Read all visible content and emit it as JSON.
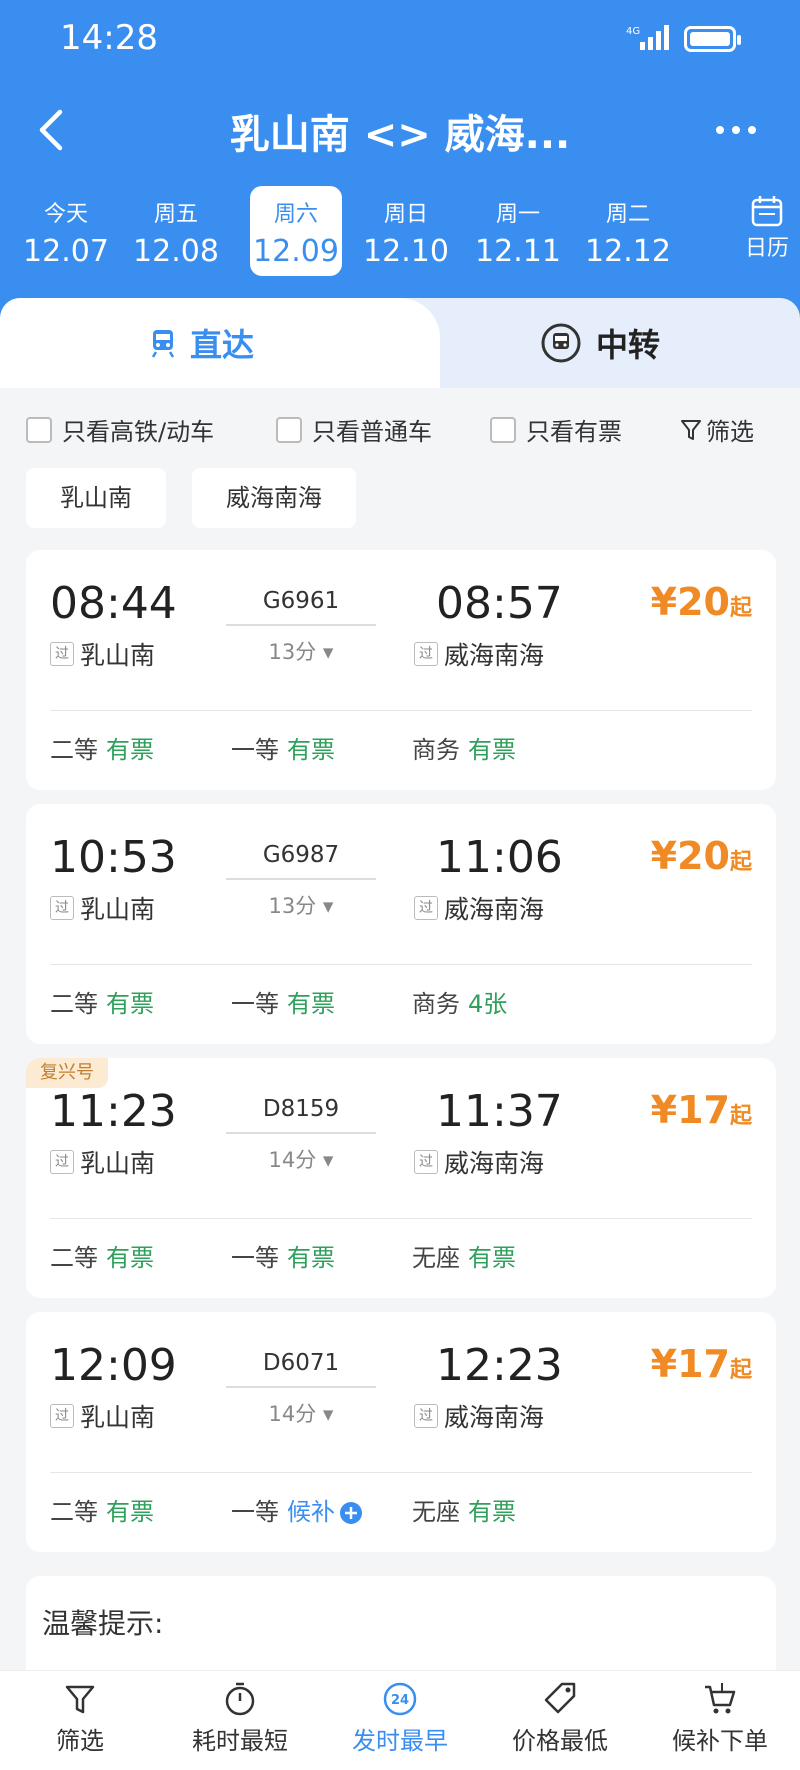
{
  "status_bar": {
    "time": "14:28",
    "network": "4G"
  },
  "header": {
    "title": "乳山南 <> 威海..."
  },
  "dates": [
    {
      "weekday": "今天",
      "date": "12.07",
      "active": false
    },
    {
      "weekday": "周五",
      "date": "12.08",
      "active": false
    },
    {
      "weekday": "周六",
      "date": "12.09",
      "active": true
    },
    {
      "weekday": "周日",
      "date": "12.10",
      "active": false
    },
    {
      "weekday": "周一",
      "date": "12.11",
      "active": false
    },
    {
      "weekday": "周二",
      "date": "12.12",
      "active": false
    }
  ],
  "calendar_label": "日历",
  "tabs": {
    "direct": "直达",
    "transfer": "中转"
  },
  "filters": {
    "high_speed": "只看高铁/动车",
    "normal": "只看普通车",
    "available": "只看有票",
    "filter_link": "筛选"
  },
  "stations": [
    "乳山南",
    "威海南海"
  ],
  "pass_badge": "过",
  "price_suffix": "起",
  "trains": [
    {
      "dep": "08:44",
      "arr": "08:57",
      "no": "G6961",
      "duration": "13分",
      "from": "乳山南",
      "to": "威海南海",
      "price": "¥20",
      "tag": "",
      "seats": [
        {
          "class": "二等",
          "status": "有票",
          "wait": false
        },
        {
          "class": "一等",
          "status": "有票",
          "wait": false
        },
        {
          "class": "商务",
          "status": "有票",
          "wait": false
        }
      ]
    },
    {
      "dep": "10:53",
      "arr": "11:06",
      "no": "G6987",
      "duration": "13分",
      "from": "乳山南",
      "to": "威海南海",
      "price": "¥20",
      "tag": "",
      "seats": [
        {
          "class": "二等",
          "status": "有票",
          "wait": false
        },
        {
          "class": "一等",
          "status": "有票",
          "wait": false
        },
        {
          "class": "商务",
          "status": "4张",
          "wait": false
        }
      ]
    },
    {
      "dep": "11:23",
      "arr": "11:37",
      "no": "D8159",
      "duration": "14分",
      "from": "乳山南",
      "to": "威海南海",
      "price": "¥17",
      "tag": "复兴号",
      "seats": [
        {
          "class": "二等",
          "status": "有票",
          "wait": false
        },
        {
          "class": "一等",
          "status": "有票",
          "wait": false
        },
        {
          "class": "无座",
          "status": "有票",
          "wait": false
        }
      ]
    },
    {
      "dep": "12:09",
      "arr": "12:23",
      "no": "D6071",
      "duration": "14分",
      "from": "乳山南",
      "to": "威海南海",
      "price": "¥17",
      "tag": "",
      "seats": [
        {
          "class": "二等",
          "status": "有票",
          "wait": false
        },
        {
          "class": "一等",
          "status": "候补",
          "wait": true
        },
        {
          "class": "无座",
          "status": "有票",
          "wait": false
        }
      ]
    }
  ],
  "tip": {
    "title": "温馨提示:"
  },
  "bottom_bar": [
    {
      "label": "筛选",
      "icon": "filter-icon",
      "active": false
    },
    {
      "label": "耗时最短",
      "icon": "timer-icon",
      "active": false
    },
    {
      "label": "发时最早",
      "icon": "clock-24-icon",
      "active": true
    },
    {
      "label": "价格最低",
      "icon": "price-tag-icon",
      "active": false
    },
    {
      "label": "候补下单",
      "icon": "cart-icon",
      "active": false
    }
  ],
  "colors": {
    "brand": "#3a8ef0",
    "price": "#f08a24",
    "available": "#2ea05b"
  }
}
